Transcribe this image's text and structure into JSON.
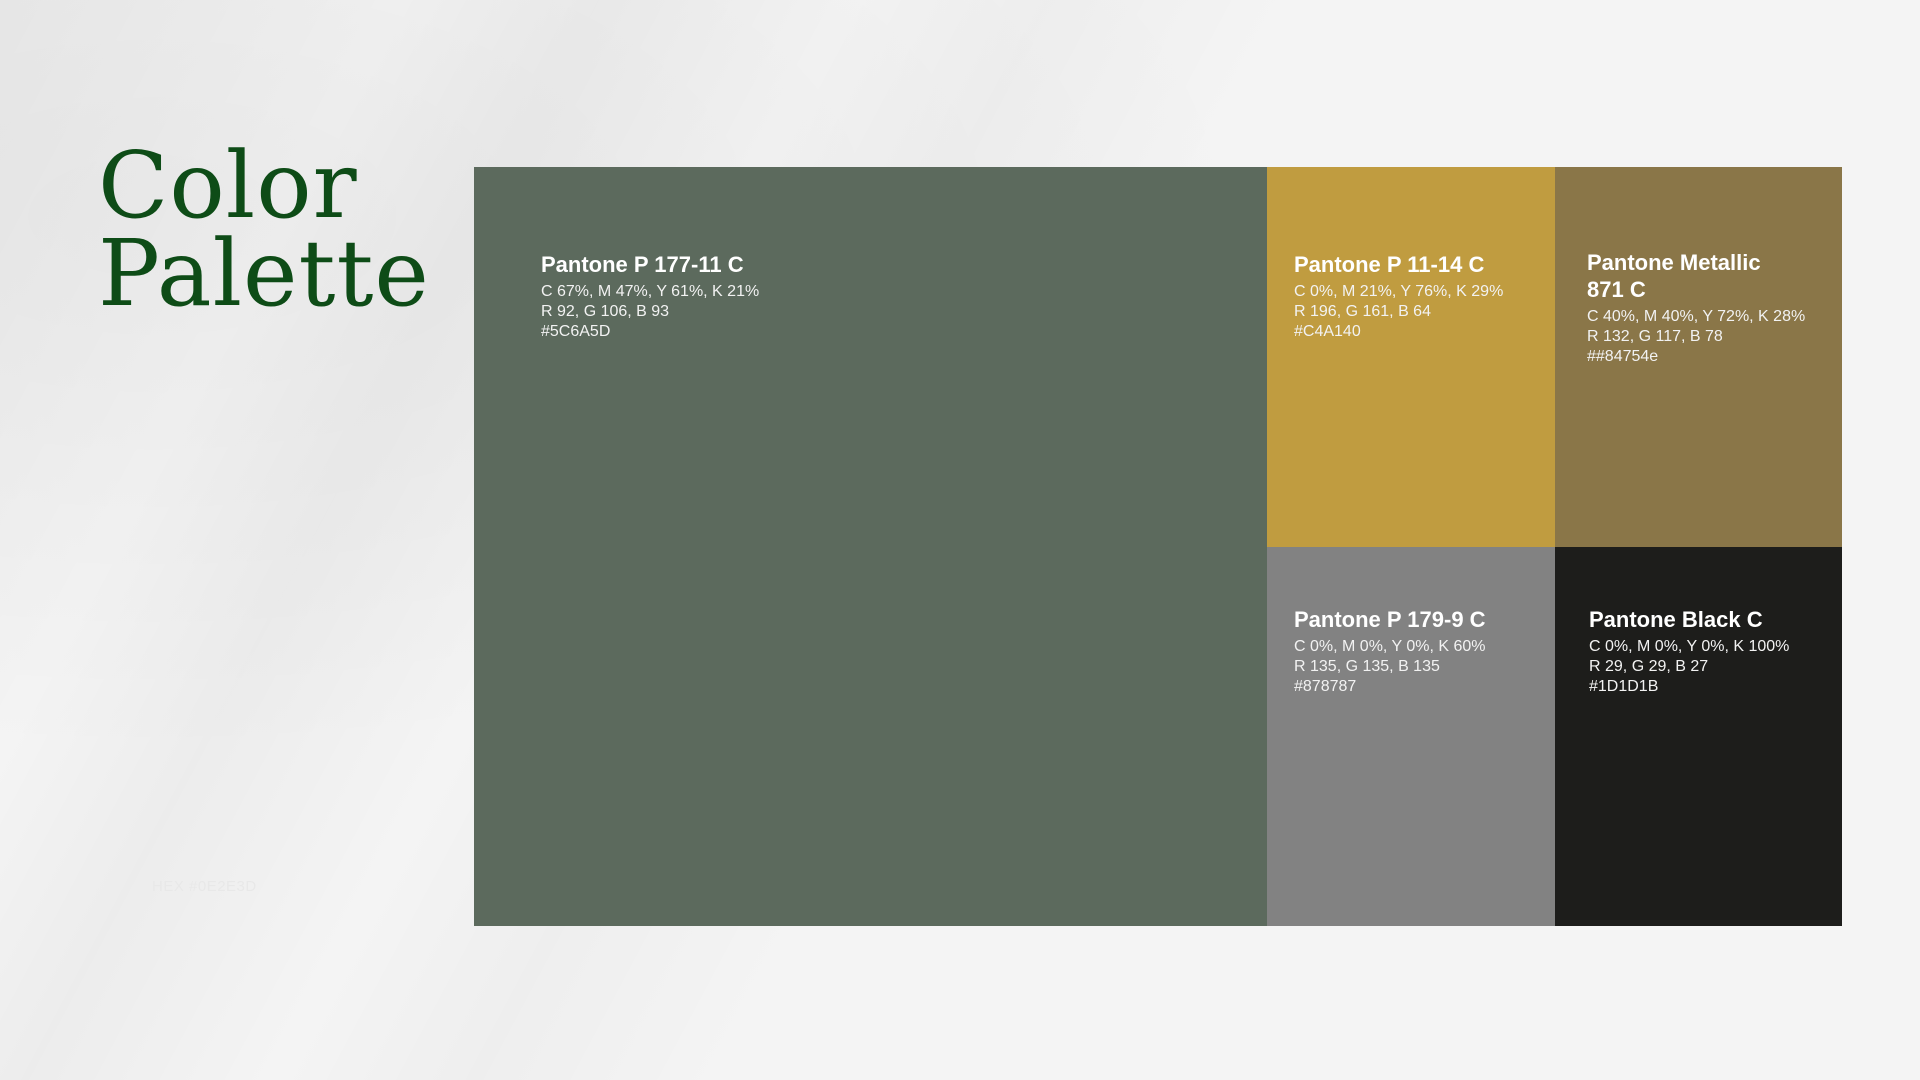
{
  "title": {
    "line1": "Color",
    "line2": "Palette",
    "color": "#0e4c17"
  },
  "hex_note": "HEX #0E2E3D",
  "swatches": [
    {
      "id": "main",
      "name": "Pantone P 177-11 C",
      "cmyk": "C 67%, M 47%, Y 61%, K 21%",
      "rgb": "R 92, G 106, B 93",
      "hex": "#5C6A5D",
      "color": "#5c6a5d"
    },
    {
      "id": "gold",
      "name": "Pantone P 11-14 C",
      "cmyk": "C 0%, M 21%, Y 76%, K 29%",
      "rgb": "R 196, G 161, B 64",
      "hex": "#C4A140",
      "color": "#c09c40"
    },
    {
      "id": "olive",
      "name": "Pantone Metallic 871 C",
      "cmyk": "C 40%, M 40%, Y 72%, K 28%",
      "rgb": "R 132, G 117, B 78",
      "hex": "##84754e",
      "color": "#8a7648"
    },
    {
      "id": "gray",
      "name": "Pantone P 179-9 C",
      "cmyk": "C 0%, M 0%, Y 0%, K 60%",
      "rgb": "R 135, G 135, B 135",
      "hex": "#878787",
      "color": "#828282"
    },
    {
      "id": "black",
      "name": "Pantone Black C",
      "cmyk": "C 0%, M 0%, Y 0%, K 100%",
      "rgb": "R 29, G 29, B 27",
      "hex": "#1D1D1B",
      "color": "#1d1d1b"
    }
  ]
}
